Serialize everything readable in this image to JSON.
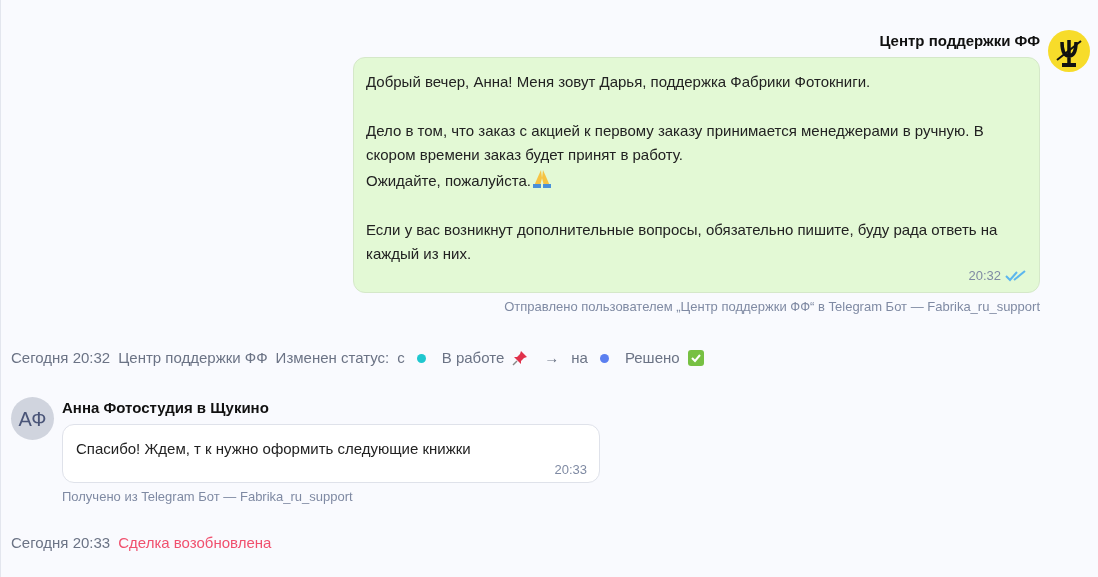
{
  "outgoing_message": {
    "sender": "Центр поддержки ФФ",
    "paragraphs": [
      {
        "lines": [
          {
            "kind": "text",
            "text": "Добрый вечер, Анна! Меня зовут Дарья, поддержка Фабрики Фотокниги."
          }
        ]
      },
      {
        "lines": [
          {
            "kind": "text",
            "text": "Дело в том, что заказ с акцией к первому заказу принимается менеджерами в ручную. В скором времени заказ будет принят в работу."
          },
          {
            "kind": "emoji",
            "text": "Ожидайте, пожалуйста."
          }
        ]
      },
      {
        "lines": [
          {
            "kind": "text",
            "text": "Если у вас возникнут дополнительные вопросы, обязательно пишите, буду рада ответь на каждый из них."
          }
        ]
      }
    ],
    "time": "20:32",
    "read": true,
    "meta": "Отправлено пользователем „Центр поддержки ФФ“ в Telegram Бот — Fabrika_ru_support"
  },
  "status_event": {
    "date": "Сегодня 20:32",
    "author": "Центр поддержки ФФ",
    "label": "Изменен статус:",
    "from_word": "с",
    "from": {
      "name": "В работе",
      "color": "#1fc7cf"
    },
    "arrow": "→",
    "to_word": "на",
    "to": {
      "name": "Решено",
      "color": "#5b7ff0"
    }
  },
  "incoming_message": {
    "avatar": "АФ",
    "sender": "Анна Фотостудия в Щукино",
    "text": "Спасибо! Ждем, т к нужно оформить следующие книжки",
    "time": "20:33",
    "meta": "Получено из Telegram Бот — Fabrika_ru_support"
  },
  "deal_event": {
    "date": "Сегодня 20:33",
    "text": "Сделка возобновлена"
  }
}
